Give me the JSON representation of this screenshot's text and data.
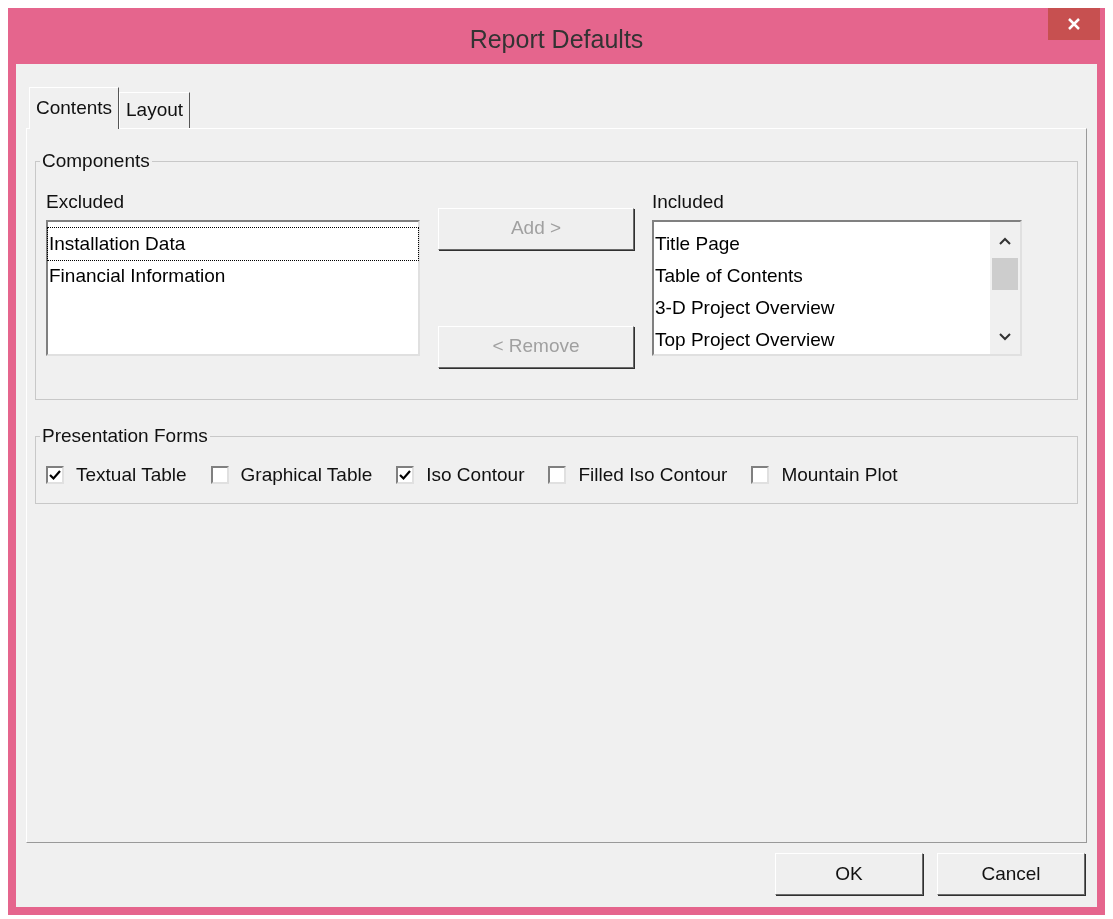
{
  "window": {
    "title": "Report Defaults"
  },
  "tabs": [
    {
      "label": "Contents",
      "selected": true
    },
    {
      "label": "Layout",
      "selected": false
    }
  ],
  "components": {
    "title": "Components",
    "excluded": {
      "label": "Excluded",
      "items": [
        {
          "label": "Installation Data",
          "selected": true
        },
        {
          "label": "Financial Information",
          "selected": false
        }
      ]
    },
    "add_button": {
      "label": "Add >",
      "disabled": true
    },
    "remove_button": {
      "label": "< Remove",
      "disabled": true
    },
    "included": {
      "label": "Included",
      "items": [
        {
          "label": "Title Page",
          "selected": false
        },
        {
          "label": "Table of Contents",
          "selected": false
        },
        {
          "label": "3-D Project Overview",
          "selected": false
        },
        {
          "label": "Top Project Overview",
          "selected": false
        }
      ]
    }
  },
  "presentation_forms": {
    "title": "Presentation Forms",
    "options": [
      {
        "label": "Textual Table",
        "checked": true
      },
      {
        "label": "Graphical Table",
        "checked": false
      },
      {
        "label": "Iso Contour",
        "checked": true
      },
      {
        "label": "Filled Iso Contour",
        "checked": false
      },
      {
        "label": "Mountain Plot",
        "checked": false
      }
    ]
  },
  "buttons": [
    {
      "label": "OK"
    },
    {
      "label": "Cancel"
    }
  ]
}
